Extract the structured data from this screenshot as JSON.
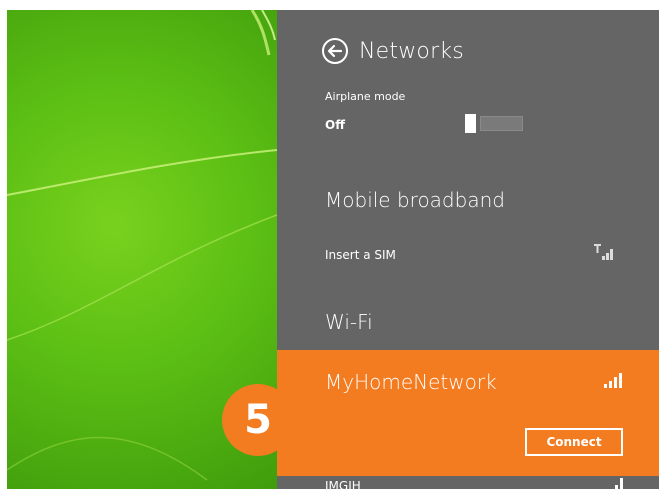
{
  "panel": {
    "title": "Networks",
    "back_icon": "back-arrow-circle-icon",
    "background_color": "#656565",
    "accent_color": "#f47c20"
  },
  "airplane_mode": {
    "label": "Airplane mode",
    "state": "Off",
    "enabled": false
  },
  "mobile_broadband": {
    "heading": "Mobile broadband",
    "status": "Insert a SIM",
    "icon": "no-sim-signal-icon"
  },
  "wifi": {
    "heading": "Wi-Fi",
    "networks": [
      {
        "name": "MyHomeNetwork",
        "selected": true,
        "icon": "wifi-signal-icon",
        "action_label": "Connect"
      },
      {
        "name": "JMGIH",
        "selected": false,
        "icon": "wifi-signal-icon"
      }
    ]
  },
  "step_badge": {
    "number": "5",
    "color": "#f47c20"
  },
  "desktop": {
    "background_color": "#5cbf14"
  }
}
